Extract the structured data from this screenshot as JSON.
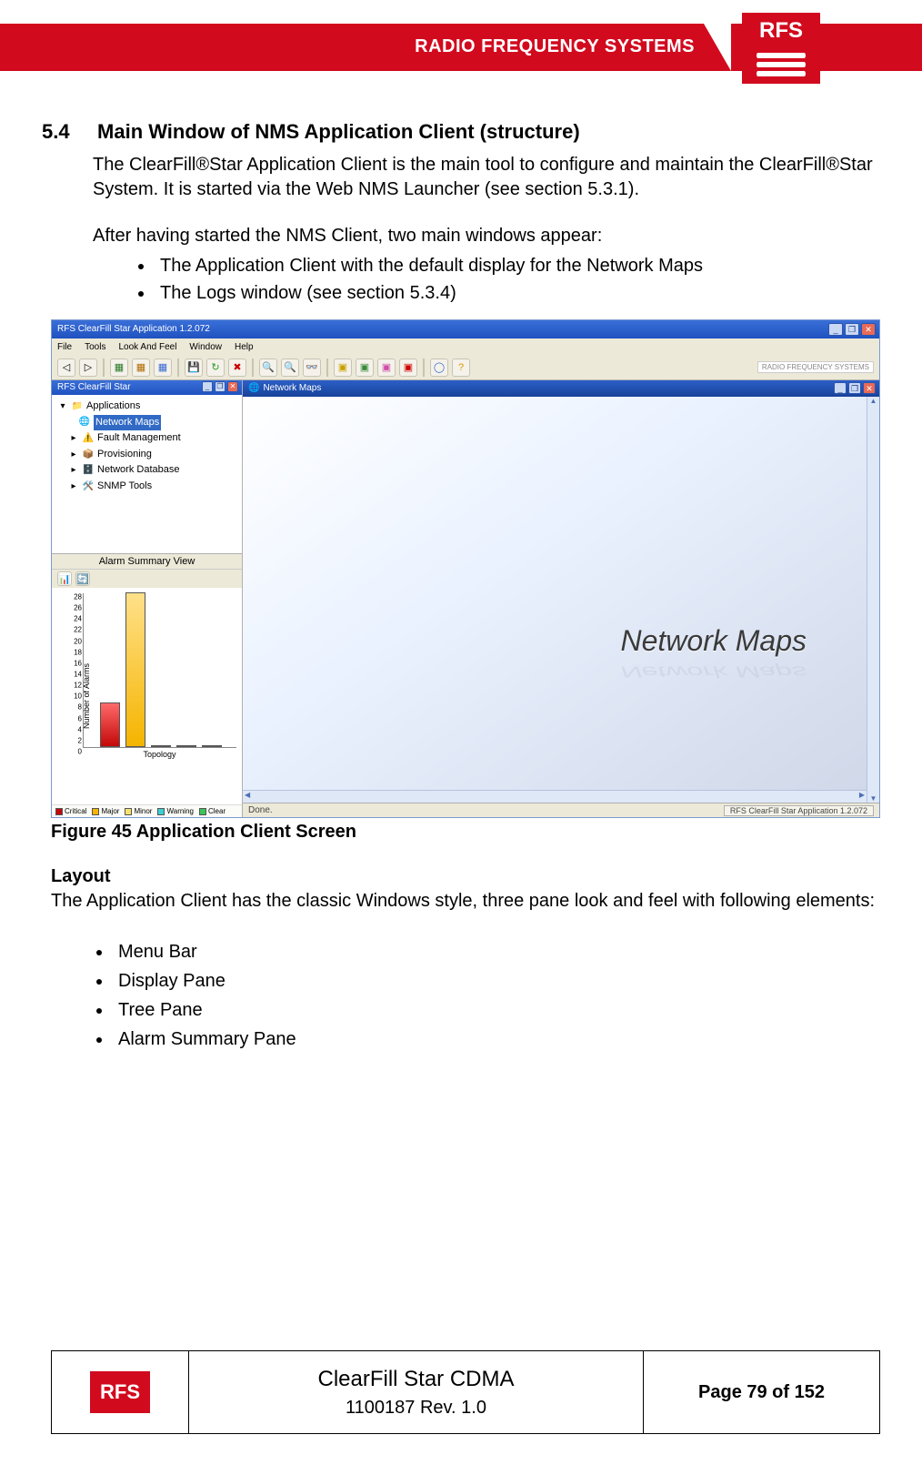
{
  "header": {
    "brand": "RADIO FREQUENCY SYSTEMS",
    "logo": "RFS"
  },
  "section": {
    "number": "5.4",
    "title": "Main Window of NMS Application Client (structure)"
  },
  "para1": "The ClearFill®Star Application Client is the main tool to configure and maintain the ClearFill®Star System. It is started via the Web NMS Launcher (see section 5.3.1).",
  "para2": "After having started the NMS Client, two main windows appear:",
  "list1": [
    "The Application Client with the default display for the Network Maps",
    "The Logs window (see section 5.3.4)"
  ],
  "screenshot": {
    "window_title": "RFS ClearFill Star Application 1.2.072",
    "menu": [
      "File",
      "Tools",
      "Look And Feel",
      "Window",
      "Help"
    ],
    "toolbar_logo": "RADIO FREQUENCY SYSTEMS",
    "tree": {
      "title": "RFS ClearFill Star",
      "root": "Applications",
      "items": [
        "Network Maps",
        "Fault Management",
        "Provisioning",
        "Network Database",
        "SNMP Tools"
      ],
      "selected_index": 0
    },
    "alarm": {
      "title": "Alarm Summary View",
      "ylabel": "Number of Alarms",
      "xlabel": "Topology",
      "legend": [
        "Critical",
        "Major",
        "Minor",
        "Warning",
        "Clear"
      ]
    },
    "inner": {
      "title": "Network Maps",
      "canvas_text": "Network Maps"
    },
    "status": {
      "left": "Done.",
      "task": "RFS ClearFill Star Application 1.2.072"
    }
  },
  "chart_data": {
    "type": "bar",
    "categories": [
      "Critical",
      "Major",
      "Minor",
      "Warning",
      "Clear"
    ],
    "values": [
      8,
      28,
      0,
      0,
      0
    ],
    "title": "Alarm Summary View",
    "xlabel": "Topology",
    "ylabel": "Number of Alarms",
    "ylim": [
      0,
      28
    ],
    "yticks": [
      0,
      2,
      4,
      6,
      8,
      10,
      12,
      14,
      16,
      18,
      20,
      22,
      24,
      26,
      28
    ],
    "colors": {
      "Critical": "#c30808",
      "Major": "#f5b400",
      "Minor": "#f7e26b",
      "Warning": "#3acfd4",
      "Clear": "#3ac45a"
    }
  },
  "figure_caption": "Figure 45 Application Client Screen",
  "layout_heading": "Layout",
  "layout_para": "The Application Client has the classic Windows style, three pane look and feel with following elements:",
  "layout_items": [
    "Menu Bar",
    "Display Pane",
    "Tree Pane",
    "Alarm Summary Pane"
  ],
  "footer": {
    "logo": "RFS",
    "title": "ClearFill Star CDMA",
    "sub": "1100187 Rev. 1.0",
    "page_label": "Page 79 of 152"
  }
}
